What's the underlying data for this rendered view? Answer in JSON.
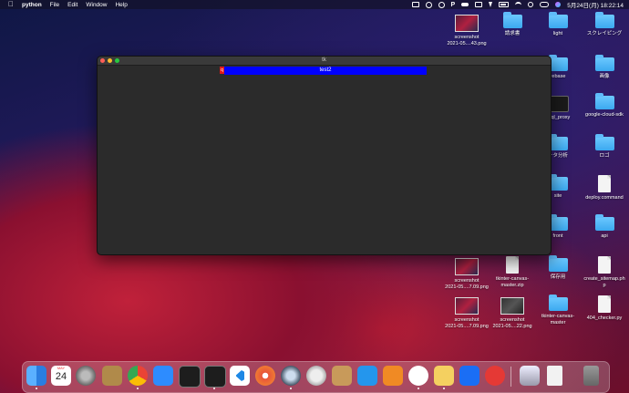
{
  "menubar": {
    "apple": "",
    "app": "python",
    "menus": [
      "File",
      "Edit",
      "Window",
      "Help"
    ],
    "datetime": "5月24日(月)  18:22:14"
  },
  "window": {
    "title": "tk",
    "red_tag_label": "q",
    "blue_bar_label": "test2"
  },
  "desktop": {
    "items": [
      {
        "label": "screenshot\n2021-05....43.png"
      },
      {
        "label": "請求書"
      },
      {
        "label": "light"
      },
      {
        "label": "スクレイピング"
      },
      {
        "label": "rebase"
      },
      {
        "label": "画像"
      },
      {
        "label": "_sql_proxy"
      },
      {
        "label": "google-cloud-sdk"
      },
      {
        "label": "ータ分析"
      },
      {
        "label": "ロゴ"
      },
      {
        "label": "site"
      },
      {
        "label": "deploy.command"
      },
      {
        "label": "front"
      },
      {
        "label": "api"
      },
      {
        "label": "screenshot\n2021-05....7.09.png"
      },
      {
        "label": "tkinter-canvas-\nmaster.zip"
      },
      {
        "label": "保存用"
      },
      {
        "label": "create_sitemap.ph\np"
      },
      {
        "label": "screenshot\n2021-05....7.09.png"
      },
      {
        "label": "screenshot\n2021-05....22.png"
      },
      {
        "label": "tkinter-canvas-\nmaster"
      },
      {
        "label": "404_checker.py"
      }
    ]
  },
  "dock": {
    "calendar_day": "24",
    "calendar_month": "MAY"
  }
}
